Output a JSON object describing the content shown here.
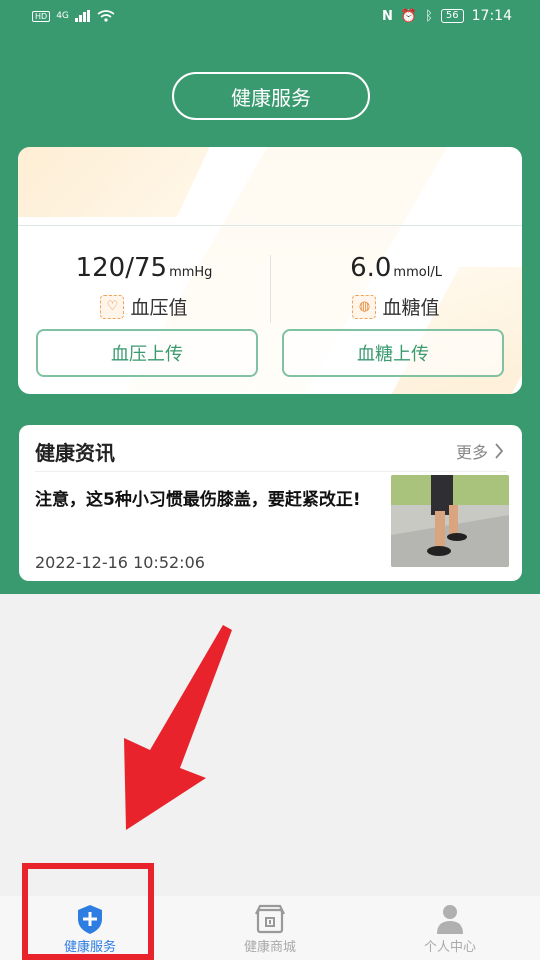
{
  "status_bar": {
    "network": "4G",
    "time": "17:14",
    "battery": "56"
  },
  "header": {
    "title": "健康服务"
  },
  "readings": {
    "blood_pressure": {
      "value": "120/75",
      "unit": "mmHg",
      "label": "血压值",
      "button": "血压上传"
    },
    "blood_sugar": {
      "value": "6.0",
      "unit": "mmol/L",
      "label": "血糖值",
      "button": "血糖上传"
    }
  },
  "news": {
    "title": "健康资讯",
    "more": "更多",
    "item": {
      "headline": "注意，这5种小习惯最伤膝盖，要赶紧改正!",
      "date": "2022-12-16 10:52:06"
    }
  },
  "tabbar": {
    "tabs": [
      {
        "label": "健康服务",
        "icon": "shield-plus-icon",
        "active": true
      },
      {
        "label": "健康商城",
        "icon": "store-icon",
        "active": false
      },
      {
        "label": "个人中心",
        "icon": "person-icon",
        "active": false
      }
    ]
  },
  "colors": {
    "brand_green": "#3a9a6f",
    "active_tab": "#2e7de1",
    "highlight_red": "#e8232b"
  }
}
